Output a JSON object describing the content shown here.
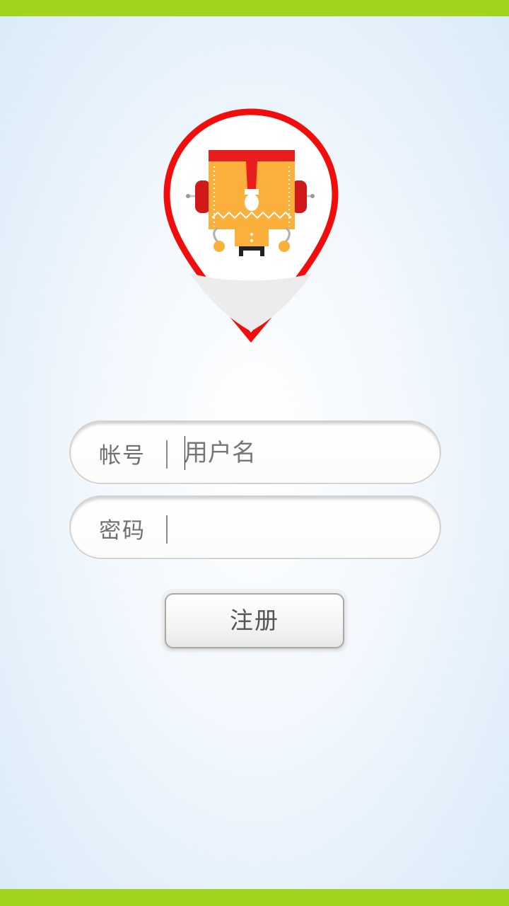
{
  "colors": {
    "accent_bar": "#a2d31f",
    "pin_red": "#f20d0d",
    "robot_orange": "#fbb03b"
  },
  "logo": {
    "icon": "robot-map-pin-icon"
  },
  "form": {
    "account": {
      "label": "帐号",
      "placeholder": "用户名",
      "value": ""
    },
    "password": {
      "label": "密码",
      "placeholder": "",
      "value": ""
    },
    "register_label": "注册"
  }
}
